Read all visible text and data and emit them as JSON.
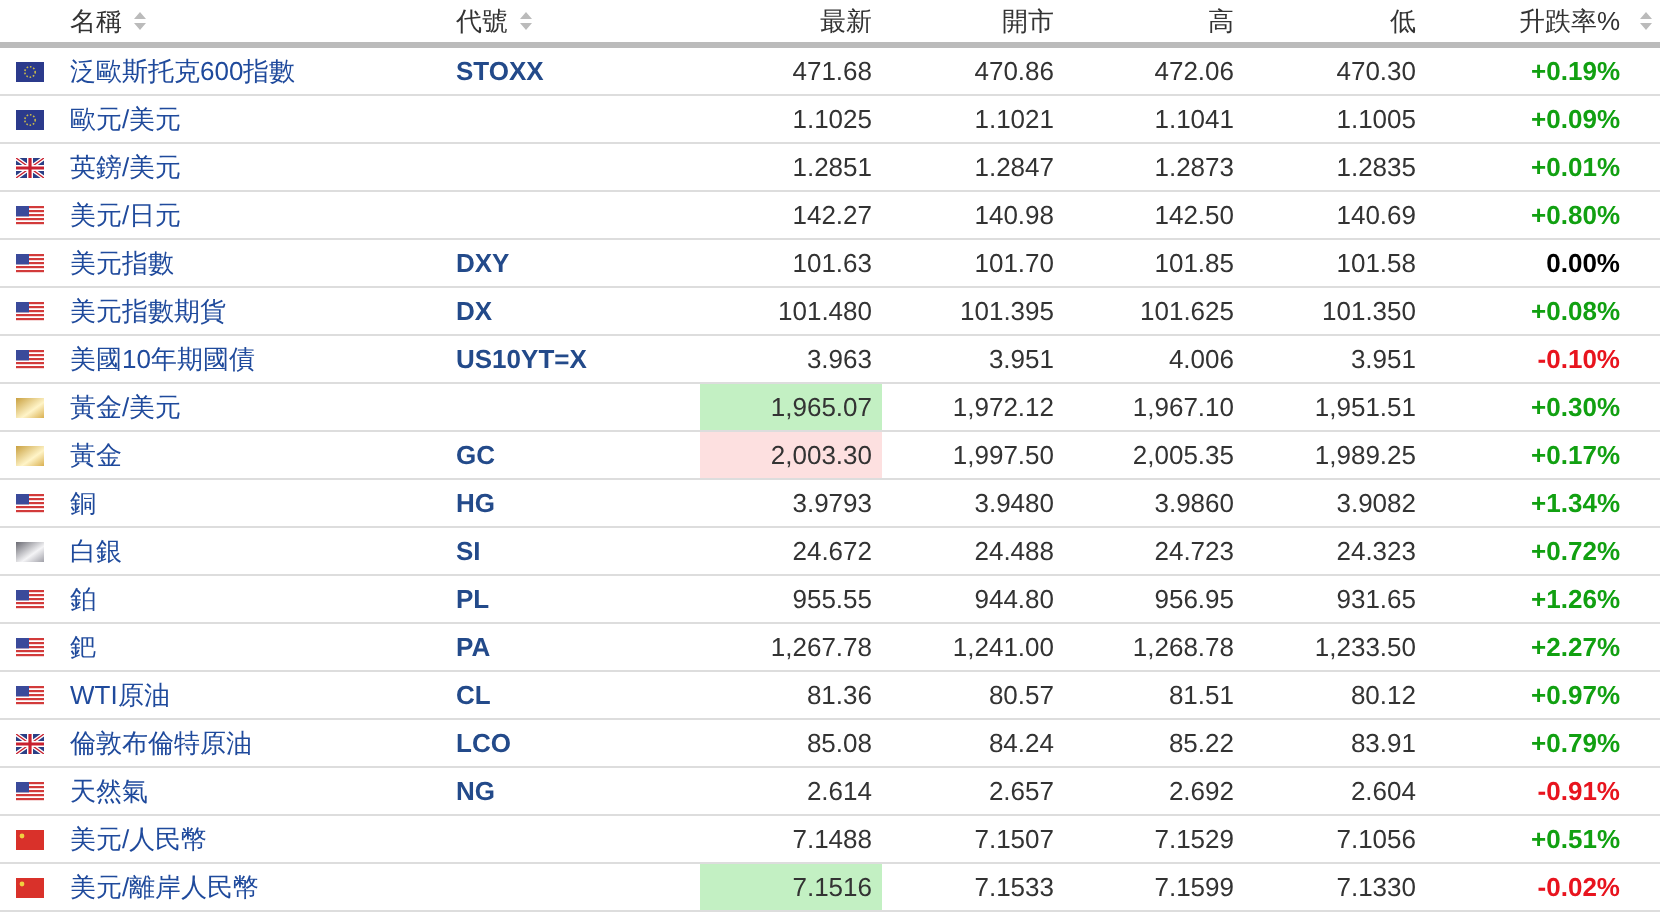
{
  "table": {
    "columns": [
      {
        "label": "名稱",
        "sortable": true
      },
      {
        "label": "代號",
        "sortable": true
      },
      {
        "label": "最新",
        "sortable": false
      },
      {
        "label": "開市",
        "sortable": false
      },
      {
        "label": "高",
        "sortable": false
      },
      {
        "label": "低",
        "sortable": false
      },
      {
        "label": "升跌率%",
        "sortable": true
      }
    ],
    "rows": [
      {
        "kind": "eu",
        "name": "泛歐斯托克600指數",
        "symbol": "STOXX",
        "last": "471.68",
        "ticked_up": false,
        "ticked_down": false,
        "open": "470.86",
        "high": "472.06",
        "low": "470.30",
        "change": "+0.19%",
        "gain": true,
        "loss": false
      },
      {
        "kind": "eu",
        "name": "歐元/美元",
        "symbol": "",
        "last": "1.1025",
        "ticked_up": false,
        "ticked_down": false,
        "open": "1.1021",
        "high": "1.1041",
        "low": "1.1005",
        "change": "+0.09%",
        "gain": true,
        "loss": false
      },
      {
        "kind": "uk",
        "name": "英鎊/美元",
        "symbol": "",
        "last": "1.2851",
        "ticked_up": false,
        "ticked_down": false,
        "open": "1.2847",
        "high": "1.2873",
        "low": "1.2835",
        "change": "+0.01%",
        "gain": true,
        "loss": false
      },
      {
        "kind": "us",
        "name": "美元/日元",
        "symbol": "",
        "last": "142.27",
        "ticked_up": false,
        "ticked_down": false,
        "open": "140.98",
        "high": "142.50",
        "low": "140.69",
        "change": "+0.80%",
        "gain": true,
        "loss": false
      },
      {
        "kind": "us",
        "name": "美元指數",
        "symbol": "DXY",
        "last": "101.63",
        "ticked_up": false,
        "ticked_down": false,
        "open": "101.70",
        "high": "101.85",
        "low": "101.58",
        "change": "0.00%",
        "gain": false,
        "loss": false
      },
      {
        "kind": "us",
        "name": "美元指數期貨",
        "symbol": "DX",
        "last": "101.480",
        "ticked_up": false,
        "ticked_down": false,
        "open": "101.395",
        "high": "101.625",
        "low": "101.350",
        "change": "+0.08%",
        "gain": true,
        "loss": false
      },
      {
        "kind": "us",
        "name": "美國10年期國債",
        "symbol": "US10YT=X",
        "last": "3.963",
        "ticked_up": false,
        "ticked_down": false,
        "open": "3.951",
        "high": "4.006",
        "low": "3.951",
        "change": "-0.10%",
        "gain": false,
        "loss": true
      },
      {
        "kind": "gold",
        "name": "黃金/美元",
        "symbol": "",
        "last": "1,965.07",
        "ticked_up": true,
        "ticked_down": false,
        "open": "1,972.12",
        "high": "1,967.10",
        "low": "1,951.51",
        "change": "+0.30%",
        "gain": true,
        "loss": false
      },
      {
        "kind": "gold",
        "name": "黃金",
        "symbol": "GC",
        "last": "2,003.30",
        "ticked_up": false,
        "ticked_down": true,
        "open": "1,997.50",
        "high": "2,005.35",
        "low": "1,989.25",
        "change": "+0.17%",
        "gain": true,
        "loss": false
      },
      {
        "kind": "us",
        "name": "銅",
        "symbol": "HG",
        "last": "3.9793",
        "ticked_up": false,
        "ticked_down": false,
        "open": "3.9480",
        "high": "3.9860",
        "low": "3.9082",
        "change": "+1.34%",
        "gain": true,
        "loss": false
      },
      {
        "kind": "silver",
        "name": "白銀",
        "symbol": "SI",
        "last": "24.672",
        "ticked_up": false,
        "ticked_down": false,
        "open": "24.488",
        "high": "24.723",
        "low": "24.323",
        "change": "+0.72%",
        "gain": true,
        "loss": false
      },
      {
        "kind": "us",
        "name": "鉑",
        "symbol": "PL",
        "last": "955.55",
        "ticked_up": false,
        "ticked_down": false,
        "open": "944.80",
        "high": "956.95",
        "low": "931.65",
        "change": "+1.26%",
        "gain": true,
        "loss": false
      },
      {
        "kind": "us",
        "name": "鈀",
        "symbol": "PA",
        "last": "1,267.78",
        "ticked_up": false,
        "ticked_down": false,
        "open": "1,241.00",
        "high": "1,268.78",
        "low": "1,233.50",
        "change": "+2.27%",
        "gain": true,
        "loss": false
      },
      {
        "kind": "us",
        "name": "WTI原油",
        "symbol": "CL",
        "last": "81.36",
        "ticked_up": false,
        "ticked_down": false,
        "open": "80.57",
        "high": "81.51",
        "low": "80.12",
        "change": "+0.97%",
        "gain": true,
        "loss": false
      },
      {
        "kind": "uk",
        "name": "倫敦布倫特原油",
        "symbol": "LCO",
        "last": "85.08",
        "ticked_up": false,
        "ticked_down": false,
        "open": "84.24",
        "high": "85.22",
        "low": "83.91",
        "change": "+0.79%",
        "gain": true,
        "loss": false
      },
      {
        "kind": "us",
        "name": "天然氣",
        "symbol": "NG",
        "last": "2.614",
        "ticked_up": false,
        "ticked_down": false,
        "open": "2.657",
        "high": "2.692",
        "low": "2.604",
        "change": "-0.91%",
        "gain": false,
        "loss": true
      },
      {
        "kind": "cn",
        "name": "美元/人民幣",
        "symbol": "",
        "last": "7.1488",
        "ticked_up": false,
        "ticked_down": false,
        "open": "7.1507",
        "high": "7.1529",
        "low": "7.1056",
        "change": "+0.51%",
        "gain": true,
        "loss": false
      },
      {
        "kind": "cn",
        "name": "美元/離岸人民幣",
        "symbol": "",
        "last": "7.1516",
        "ticked_up": true,
        "ticked_down": false,
        "open": "7.1533",
        "high": "7.1599",
        "low": "7.1330",
        "change": "-0.02%",
        "gain": false,
        "loss": true
      }
    ]
  }
}
